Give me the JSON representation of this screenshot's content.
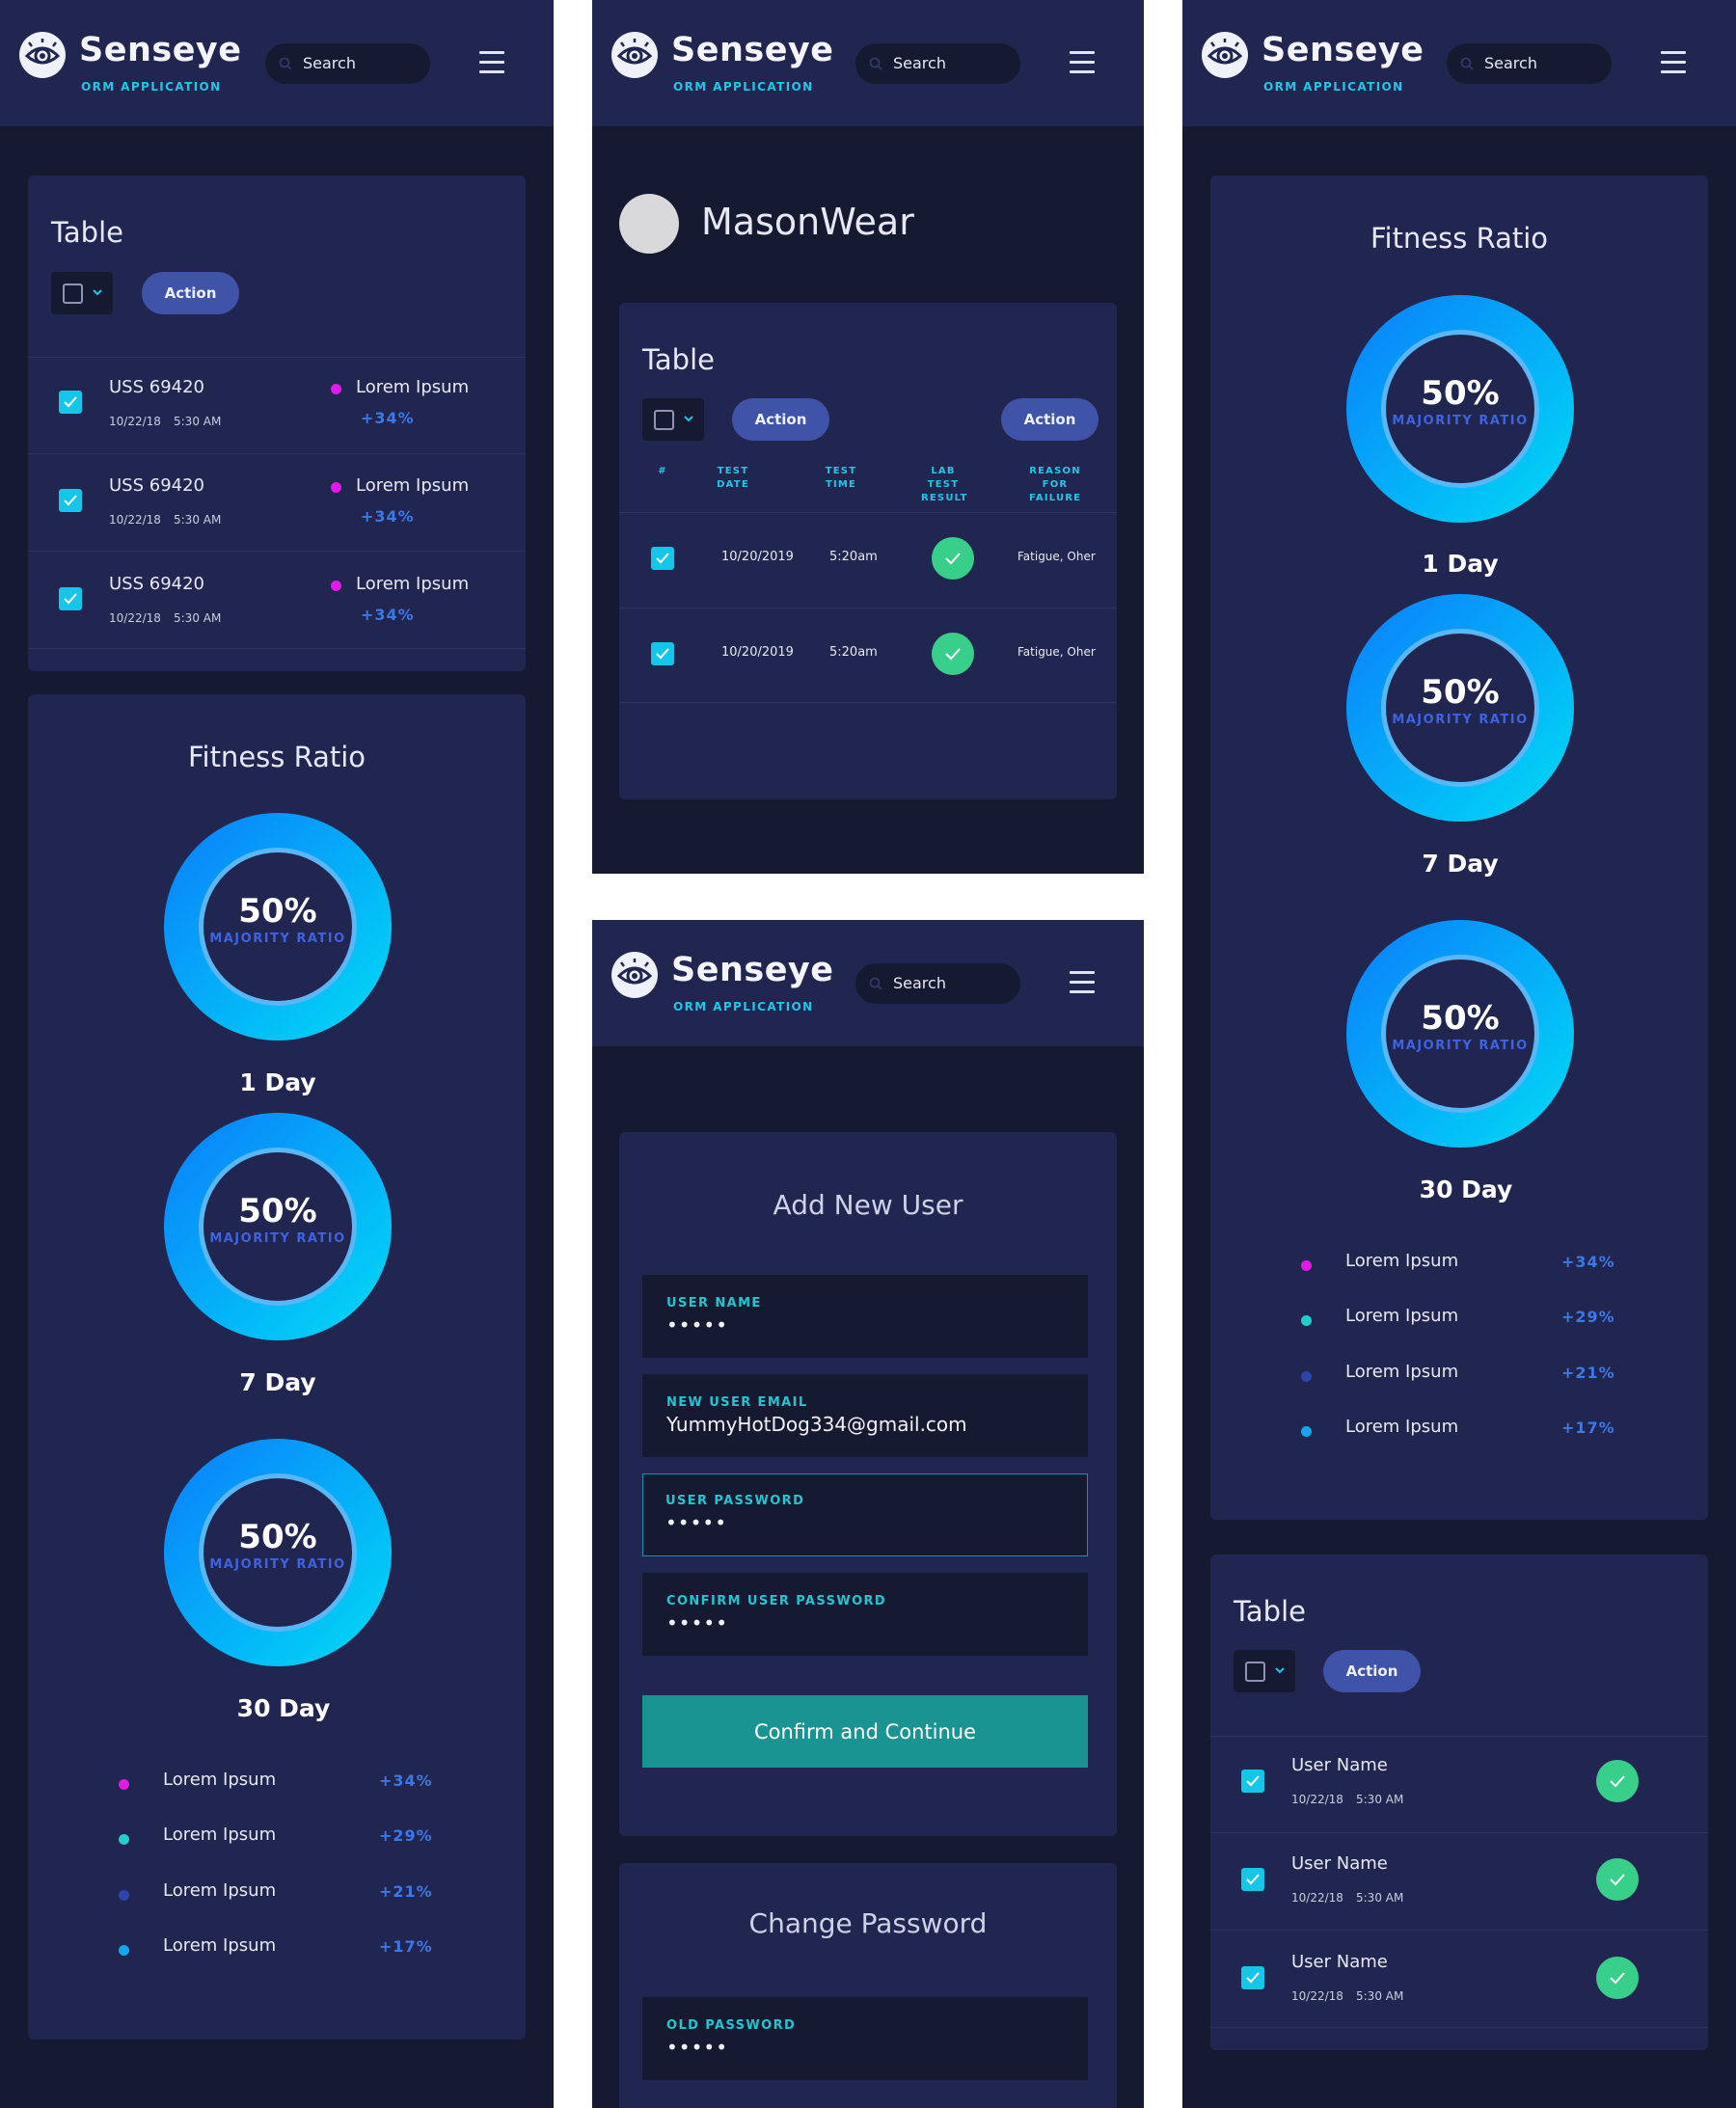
{
  "brand": {
    "name": "Senseye",
    "subtitle": "ORM APPLICATION"
  },
  "search": {
    "placeholder": "Search"
  },
  "table": {
    "title": "Table",
    "action_label": "Action",
    "rows": [
      {
        "title": "USS 69420",
        "date": "10/22/18",
        "time": "5:30 AM",
        "label": "Lorem Ipsum",
        "change": "+34%"
      },
      {
        "title": "USS 69420",
        "date": "10/22/18",
        "time": "5:30 AM",
        "label": "Lorem Ipsum",
        "change": "+34%"
      },
      {
        "title": "USS 69420",
        "date": "10/22/18",
        "time": "5:30 AM",
        "label": "Lorem Ipsum",
        "change": "+34%"
      }
    ]
  },
  "fitness": {
    "title": "Fitness Ratio",
    "rings": [
      {
        "value": "50%",
        "label": "MAJORITY RATIO",
        "period": "1 Day"
      },
      {
        "value": "50%",
        "label": "MAJORITY RATIO",
        "period": "7 Day"
      },
      {
        "value": "50%",
        "label": "MAJORITY RATIO",
        "period": "30 Day"
      }
    ],
    "legend": [
      {
        "label": "Lorem Ipsum",
        "change": "+34%",
        "color": "#e11be6"
      },
      {
        "label": "Lorem Ipsum",
        "change": "+29%",
        "color": "#1ed2c9"
      },
      {
        "label": "Lorem Ipsum",
        "change": "+21%",
        "color": "#2e44a8"
      },
      {
        "label": "Lorem Ipsum",
        "change": "+17%",
        "color": "#12a8f0"
      }
    ]
  },
  "profile": {
    "name": "MasonWear"
  },
  "lab_table": {
    "title": "Table",
    "action_left": "Action",
    "action_right": "Action",
    "headers": {
      "num": "#",
      "date": "TEST DATE",
      "time": "TEST TIME",
      "result": "LAB TEST RESULT",
      "reason": "REASON FOR FAILURE"
    },
    "rows": [
      {
        "date": "10/20/2019",
        "time": "5:20am",
        "reason": "Fatigue, Oher"
      },
      {
        "date": "10/20/2019",
        "time": "5:20am",
        "reason": "Fatigue, Oher"
      }
    ]
  },
  "add_user": {
    "title": "Add New User",
    "fields": [
      {
        "label": "USER NAME",
        "value": "•••••"
      },
      {
        "label": "NEW USER EMAIL",
        "value": "YummyHotDog334@gmail.com"
      },
      {
        "label": "USER PASSWORD",
        "value": "•••••"
      },
      {
        "label": "CONFIRM USER PASSWORD",
        "value": "•••••"
      }
    ],
    "submit": "Confirm and Continue"
  },
  "change_password": {
    "title": "Change Password",
    "fields": [
      {
        "label": "OLD PASSWORD",
        "value": "•••••"
      }
    ]
  },
  "user_table": {
    "title": "Table",
    "action_label": "Action",
    "rows": [
      {
        "name": "User Name",
        "date": "10/22/18",
        "time": "5:30 AM"
      },
      {
        "name": "User Name",
        "date": "10/22/18",
        "time": "5:30 AM"
      },
      {
        "name": "User Name",
        "date": "10/22/18",
        "time": "5:30 AM"
      }
    ]
  },
  "colors": {
    "background": "#161a30",
    "card": "#212650",
    "accent": "#15c6e8",
    "button": "#3f53a8",
    "teal_button": "#1a9393",
    "success": "#38cf8b"
  },
  "icons": [
    "eye-logo-icon",
    "search-icon",
    "hamburger-menu-icon",
    "chevron-down-icon",
    "checkmark-icon"
  ]
}
